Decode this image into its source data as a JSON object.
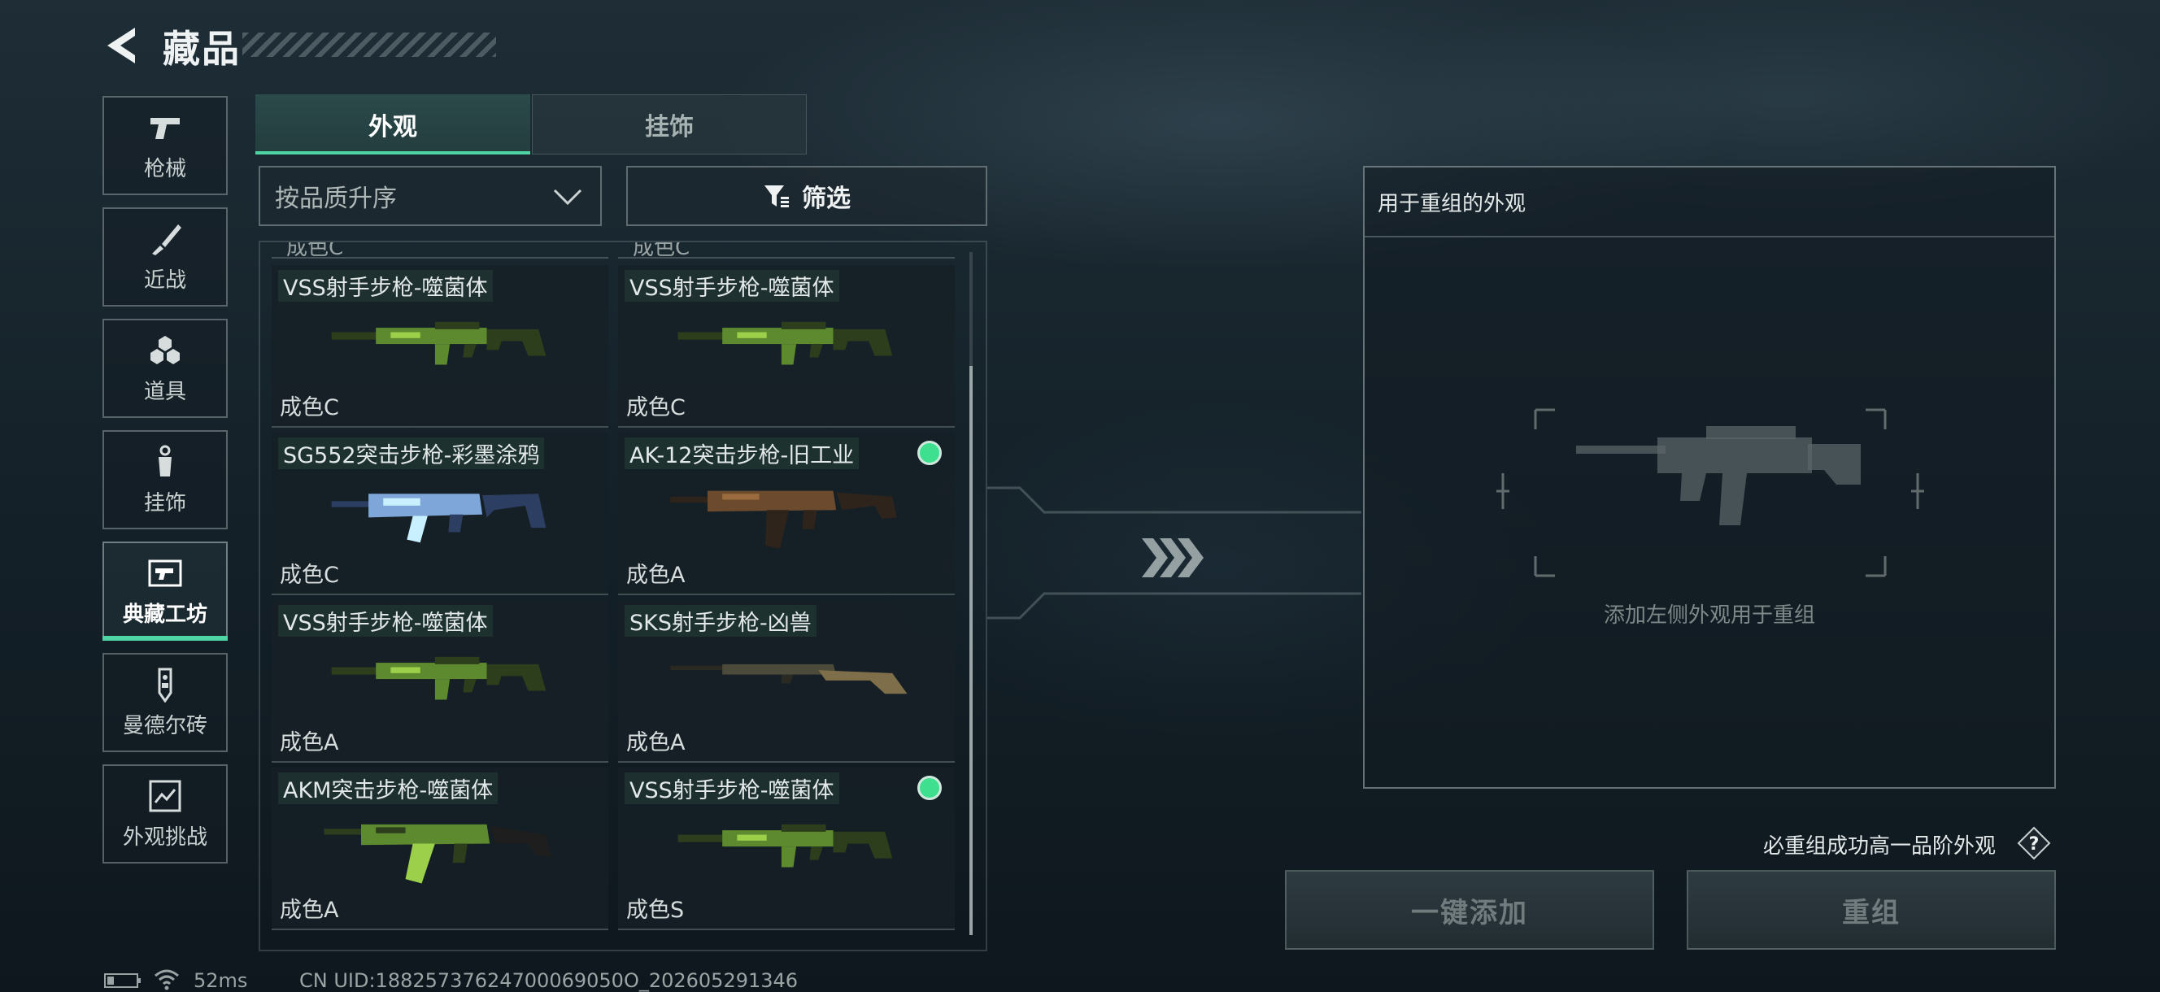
{
  "header": {
    "title": "藏品"
  },
  "nav": [
    {
      "key": "firearms",
      "label": "枪械",
      "icon": "pistol-icon"
    },
    {
      "key": "melee",
      "label": "近战",
      "icon": "knife-icon"
    },
    {
      "key": "items",
      "label": "道具",
      "icon": "grenade-icon"
    },
    {
      "key": "pendants",
      "label": "挂饰",
      "icon": "pendant-icon"
    },
    {
      "key": "collection-workshop",
      "label": "典藏工坊",
      "icon": "workshop-icon",
      "active": true
    },
    {
      "key": "mandel-brick",
      "label": "曼德尔砖",
      "icon": "brick-icon"
    },
    {
      "key": "appearance-challenge",
      "label": "外观挑战",
      "icon": "challenge-icon"
    }
  ],
  "tabs": {
    "appearance": "外观",
    "pendant": "挂饰"
  },
  "sort": {
    "label": "按品质升序"
  },
  "filter": {
    "label": "筛选"
  },
  "cards": [
    {
      "name": "VSS射手步枪-噬菌体",
      "grade": "成色C",
      "weapon": "vss",
      "skin": "green",
      "selected": false
    },
    {
      "name": "VSS射手步枪-噬菌体",
      "grade": "成色C",
      "weapon": "vss",
      "skin": "green",
      "selected": false
    },
    {
      "name": "SG552突击步枪-彩墨涂鸦",
      "grade": "成色C",
      "weapon": "sg552",
      "skin": "graffiti",
      "selected": false
    },
    {
      "name": "AK-12突击步枪-旧工业",
      "grade": "成色A",
      "weapon": "ak12",
      "skin": "rust",
      "selected": true
    },
    {
      "name": "VSS射手步枪-噬菌体",
      "grade": "成色A",
      "weapon": "vss",
      "skin": "green",
      "selected": false
    },
    {
      "name": "SKS射手步枪-凶兽",
      "grade": "成色A",
      "weapon": "sks",
      "skin": "beast",
      "selected": false
    },
    {
      "name": "AKM突击步枪-噬菌体",
      "grade": "成色A",
      "weapon": "akm",
      "skin": "green",
      "selected": false
    },
    {
      "name": "VSS射手步枪-噬菌体",
      "grade": "成色S",
      "weapon": "vss",
      "skin": "green",
      "selected": true
    }
  ],
  "partial_row_text": "成色C",
  "panel": {
    "title": "用于重组的外观",
    "hint": "添加左侧外观用于重组"
  },
  "guarantee": {
    "text": "必重组成功高一品阶外观"
  },
  "buttons": {
    "quick_add": "一键添加",
    "recombine": "重组"
  },
  "status": {
    "ping": "52ms",
    "uid": "CN UID:18825737624700069050O_202605291346"
  },
  "colors": {
    "accent": "#4fd4a4",
    "selected_dot": "#3ee08f"
  }
}
